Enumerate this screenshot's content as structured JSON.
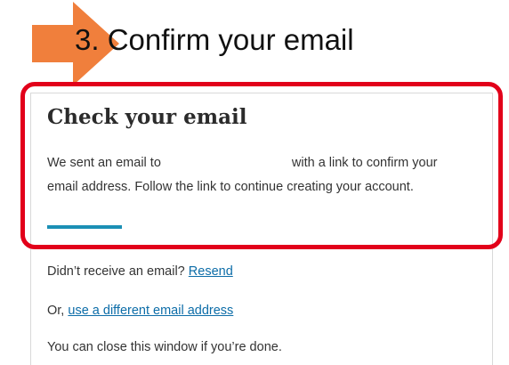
{
  "slide": {
    "step_title": "3. Confirm your email",
    "arrow_color": "#f07f3c"
  },
  "card": {
    "heading": "Check your email",
    "sent_prefix": "We sent an email to",
    "sent_suffix": "with a link to confirm your",
    "sent_line2": "email address. Follow the link to continue creating your account.",
    "progress_color": "#1b90b5"
  },
  "followup": {
    "no_email_prefix": "Didn’t receive an email?",
    "resend_link": "Resend",
    "or_prefix": "Or,",
    "different_link": "use a different email address",
    "close_note": "You can close this window if you’re done."
  },
  "highlight_color": "#e2001a"
}
